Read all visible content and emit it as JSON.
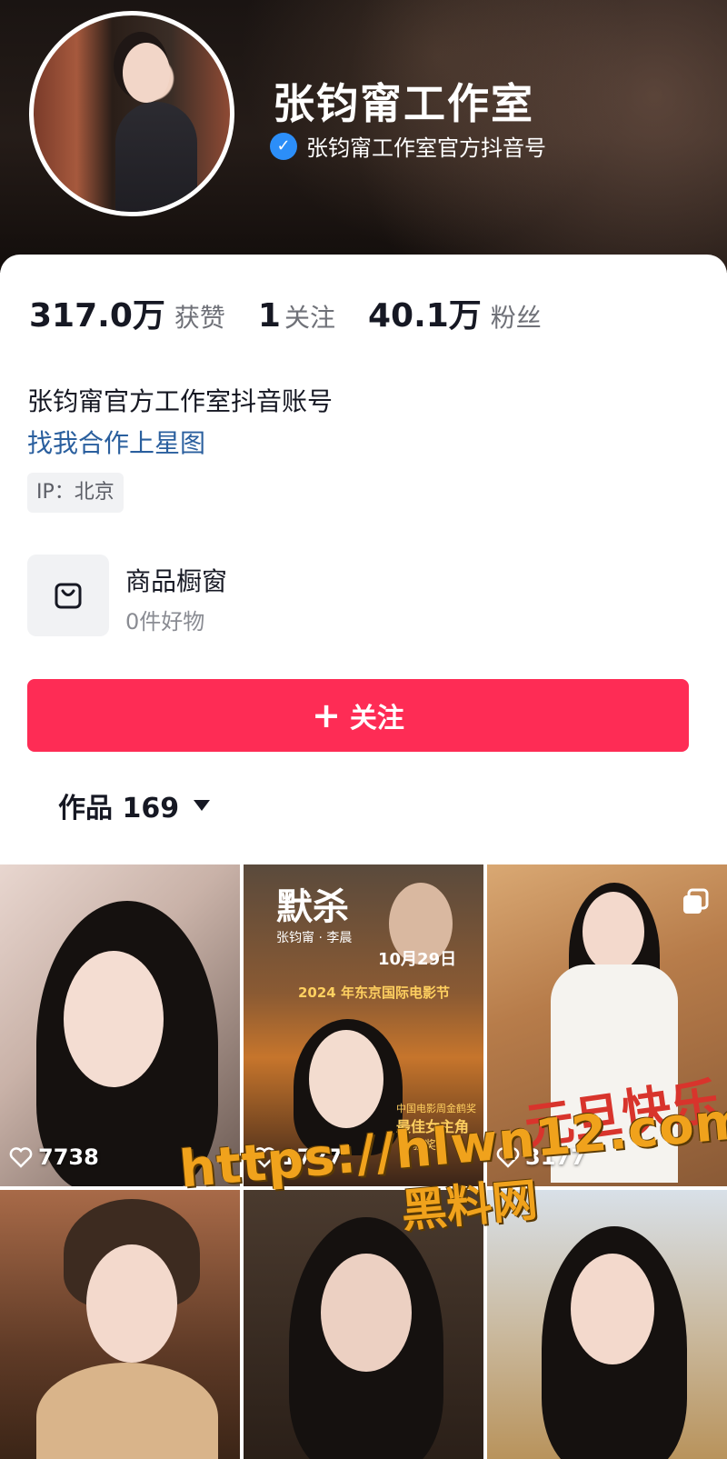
{
  "profile": {
    "name": "张钧甯工作室",
    "verified_text": "张钧甯工作室官方抖音号"
  },
  "stats": [
    {
      "value": "317.0万",
      "label": "获赞"
    },
    {
      "value": "1",
      "label": "关注"
    },
    {
      "value": "40.1万",
      "label": "粉丝"
    }
  ],
  "bio": {
    "line1": "张钧甯官方工作室抖音账号",
    "link": "找我合作上星图",
    "ip": "IP：北京"
  },
  "shop": {
    "title": "商品橱窗",
    "subtitle": "0件好物"
  },
  "follow_button": {
    "plus": "+",
    "label": "关注"
  },
  "works_tab": {
    "label": "作品 169"
  },
  "videos": [
    {
      "likes": "7738"
    },
    {
      "likes": "1727",
      "poster_title": "默杀",
      "poster_date": "10月29日",
      "poster_festival": "2024 年东京国际电影节",
      "poster_award_line1": "中国电影周金鹤奖",
      "poster_award_line2": "最佳女主角",
      "poster_award_line3": "获奖",
      "poster_cast": "张钧甯 · 李晨"
    },
    {
      "likes": "3177",
      "overlay_text": "元旦快乐"
    },
    {
      "likes": ""
    },
    {
      "likes": ""
    },
    {
      "likes": ""
    }
  ],
  "watermark": {
    "url": "https://hlwn12.com",
    "sub": "黑料网"
  },
  "colors": {
    "accent": "#fe2c55",
    "link": "#2a5f9e",
    "verify": "#2c8ef8",
    "watermark": "#f0a21c"
  }
}
